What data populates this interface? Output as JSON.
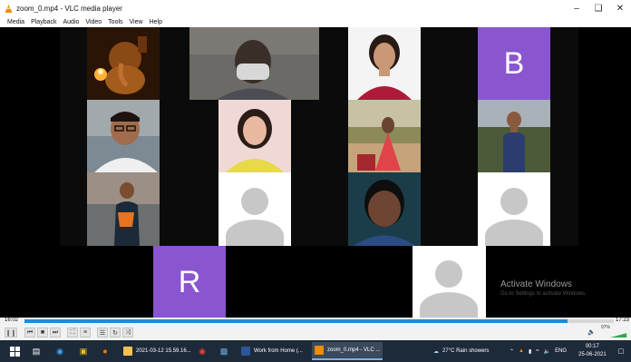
{
  "window": {
    "title": "zoom_0.mp4 - VLC media player",
    "minimize_glyph": "–",
    "maximize_glyph": "❏",
    "close_glyph": "✕"
  },
  "menu": [
    "Media",
    "Playback",
    "Audio",
    "Video",
    "Tools",
    "View",
    "Help"
  ],
  "participants": [
    {
      "type": "photo",
      "name": "ganesha-tile"
    },
    {
      "type": "photo",
      "name": "masked-man-tile"
    },
    {
      "type": "photo",
      "name": "woman-red-top-tile"
    },
    {
      "type": "letter",
      "letter": "B",
      "color": "#8a56cf"
    },
    {
      "type": "photo",
      "name": "man-glasses-tile"
    },
    {
      "type": "photo",
      "name": "woman-yellow-tile"
    },
    {
      "type": "photo",
      "name": "woman-outdoor-tile"
    },
    {
      "type": "photo",
      "name": "man-blue-shirt-tile"
    },
    {
      "type": "photo",
      "name": "man-orange-shirt-tile"
    },
    {
      "type": "avatar"
    },
    {
      "type": "photo",
      "name": "man-selfie-tile"
    },
    {
      "type": "avatar"
    },
    {
      "type": "letter",
      "letter": "R",
      "color": "#8a56cf"
    },
    {
      "type": "avatar"
    }
  ],
  "watermark": {
    "title": "Activate Windows",
    "subtitle": "Go to Settings to activate Windows."
  },
  "player": {
    "elapsed": "16:02",
    "total": "17:23",
    "progress": 0.922,
    "volume_label": "97%",
    "volume": 0.97,
    "accent": "#1f8ad6"
  },
  "controls": [
    {
      "name": "pause-button",
      "glyph": "❙❙"
    },
    {
      "name": "previous-button",
      "glyph": "⏮"
    },
    {
      "name": "stop-button",
      "glyph": "■"
    },
    {
      "name": "next-button",
      "glyph": "⏭"
    },
    {
      "name": "fullscreen-button",
      "glyph": "⛶"
    },
    {
      "name": "extended-settings-button",
      "glyph": "≡"
    },
    {
      "name": "playlist-button",
      "glyph": "☰"
    },
    {
      "name": "loop-button",
      "glyph": "↻"
    },
    {
      "name": "shuffle-button",
      "glyph": "⤨"
    }
  ],
  "taskbar": {
    "apps": [
      {
        "label": "2021-03-12 15.59.16...",
        "icon": "folder-icon",
        "color": "#f2c14e"
      },
      {
        "label": "Work from Home (...",
        "icon": "word-icon",
        "color": "#2b579a"
      },
      {
        "label": "zoom_0.mp4 - VLC ...",
        "icon": "vlc-icon",
        "color": "#f08c00",
        "active": true
      }
    ],
    "weather": "27°C  Rain showers",
    "language": "ENG",
    "time": "00:17",
    "date": "25-06-2021"
  }
}
